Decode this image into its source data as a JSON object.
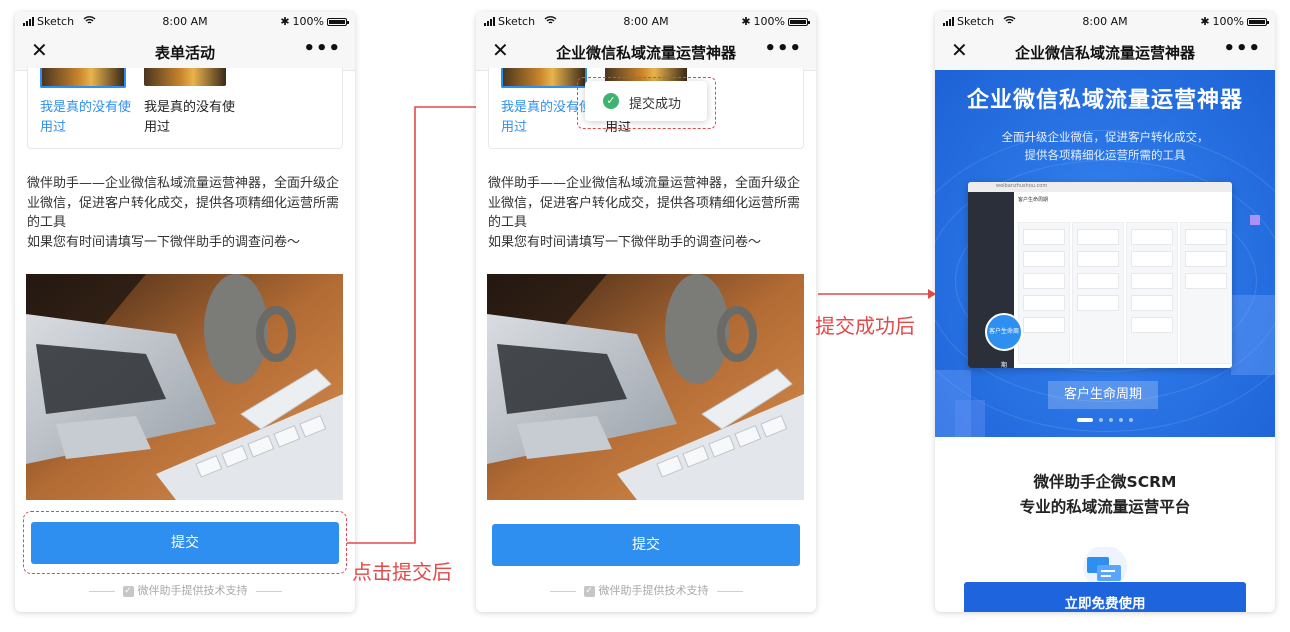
{
  "status": {
    "carrier": "Sketch",
    "time": "8:00 AM",
    "battery": "100%"
  },
  "screen1": {
    "title": "表单活动",
    "option_a": "我是真的没有使用过",
    "option_b": "我是真的没有使用过",
    "description": "微伴助手——企业微信私域流量运营神器，全面升级企业微信，促进客户转化成交，提供各项精细化运营所需的工具",
    "description2": "如果您有时间请填写一下微伴助手的调查问卷～",
    "submit_label": "提交",
    "footer": "微伴助手提供技术支持"
  },
  "screen2": {
    "title": "企业微信私域流量运营神器",
    "toast": "提交成功"
  },
  "annotations": {
    "after_submit_click": "点击提交后",
    "after_submit_success": "提交成功后"
  },
  "screen3": {
    "title": "企业微信私域流量运营神器",
    "banner_title": "企业微信私域流量运营神器",
    "banner_sub_1": "全面升级企业微信，促进客户转化成交，",
    "banner_sub_2": "提供各项精细化运营所需的工具",
    "browser_url": "weibanzhushou.com",
    "app_page_title": "客户生命周期",
    "zoom_label": "客户生命周期",
    "banner_pill": "客户生命周期",
    "carousel": {
      "count": 5,
      "active": 0
    },
    "product_line1": "微伴助手企微SCRM",
    "product_line2": "专业的私域流量运营平台",
    "cta_label": "立即免费使用"
  },
  "colors": {
    "accent": "#2f8ff0",
    "annotation": "#e34a4a",
    "banner": "#2a75e6",
    "success": "#3cb371"
  },
  "icons": [
    "signal-icon",
    "wifi-icon",
    "bluetooth-icon",
    "battery-icon",
    "close-icon",
    "more-icon",
    "check-icon",
    "success-icon",
    "arrow-icon",
    "chat-icon"
  ]
}
